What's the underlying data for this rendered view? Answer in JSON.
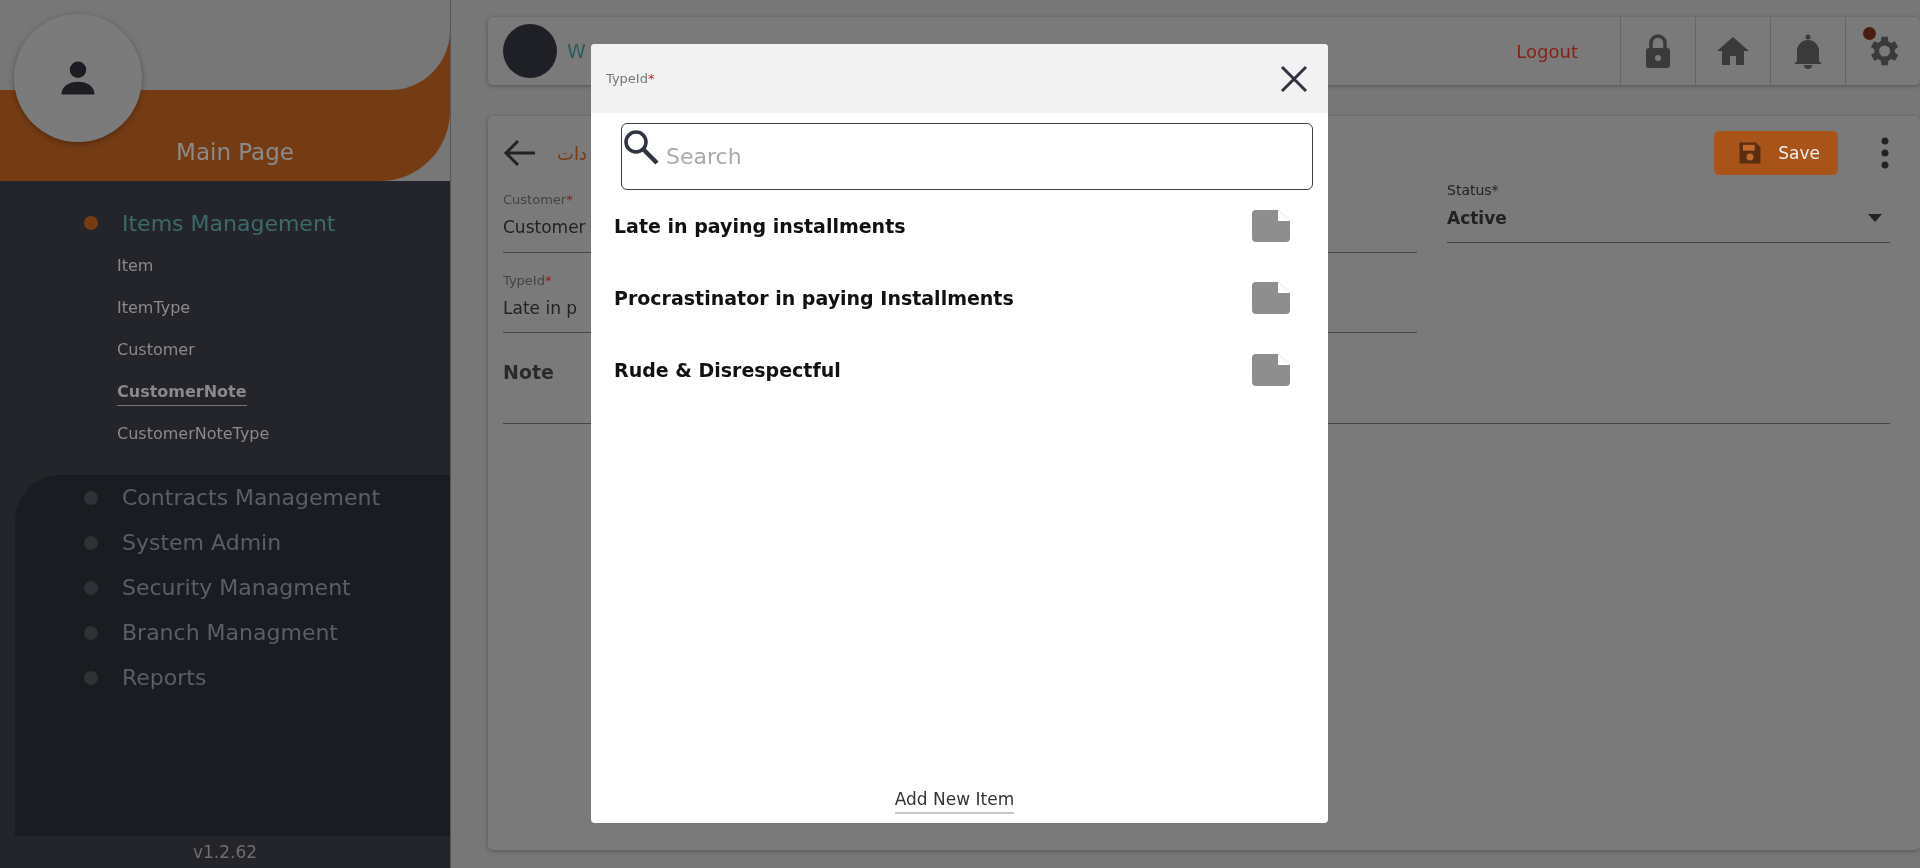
{
  "sidebar": {
    "title": "Main Page",
    "groups": [
      {
        "label": "Items Management",
        "expanded": true,
        "children": [
          {
            "label": "Item",
            "selected": false
          },
          {
            "label": "ItemType",
            "selected": false
          },
          {
            "label": "Customer",
            "selected": false
          },
          {
            "label": "CustomerNote",
            "selected": true
          },
          {
            "label": "CustomerNoteType",
            "selected": false
          }
        ]
      },
      {
        "label": "Contracts Management",
        "expanded": false
      },
      {
        "label": "System Admin",
        "expanded": false
      },
      {
        "label": "Security Managment",
        "expanded": false
      },
      {
        "label": "Branch Managment",
        "expanded": false
      },
      {
        "label": "Reports",
        "expanded": false
      }
    ],
    "version": "v1.2.62"
  },
  "header": {
    "welcome": "W",
    "logout": "Logout",
    "notification": true
  },
  "form": {
    "title": "دات",
    "save": "Save",
    "fields": [
      {
        "kind": "text",
        "label": "Customer",
        "required_mark": "*",
        "value": "Customer"
      },
      {
        "kind": "select",
        "label": "Status*",
        "value": "Active"
      },
      {
        "kind": "text",
        "label": "TypeId",
        "required_mark": "*",
        "value": "Late in p"
      },
      {
        "kind": "note",
        "label": "Note"
      }
    ]
  },
  "modal": {
    "label": "TypeId",
    "required_mark": "*",
    "search_placeholder": "Search",
    "options": [
      "Late in paying installments",
      "Procrastinator in paying Installments",
      "Rude & Disrespectful"
    ],
    "add_new": "Add New Item"
  }
}
